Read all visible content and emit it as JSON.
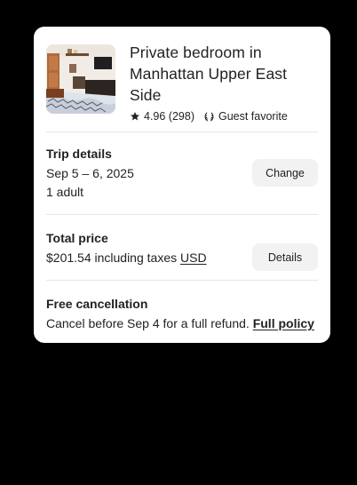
{
  "listing": {
    "title": "Private bedroom in Manhattan Upper East Side",
    "rating": "4.96 (298)",
    "badge": "Guest favorite",
    "icons": {
      "rating": "star-icon",
      "badge": "laurel-icon"
    }
  },
  "trip": {
    "label": "Trip details",
    "dates": "Sep 5 – 6, 2025",
    "guests": "1 adult",
    "change_label": "Change"
  },
  "price": {
    "label": "Total price",
    "amount_text": "$201.54 including taxes",
    "currency": "USD",
    "details_label": "Details"
  },
  "cancellation": {
    "label": "Free cancellation",
    "text": "Cancel before Sep 4 for a full refund.",
    "policy_link": "Full policy"
  }
}
